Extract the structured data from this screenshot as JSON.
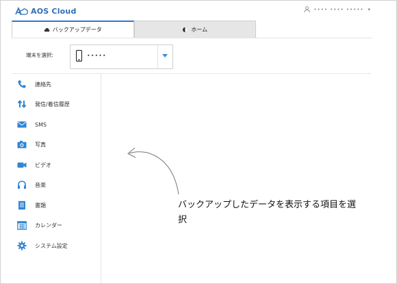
{
  "app": {
    "title": "AOS Cloud"
  },
  "user": {
    "name": "•••• •••• •••••",
    "caret": "▾"
  },
  "tabs": [
    {
      "label": "バックアップデータ",
      "icon": "cloud-icon",
      "active": true
    },
    {
      "label": "ホーム",
      "icon": "home-icon",
      "active": false
    }
  ],
  "device": {
    "label": "端末を選択:",
    "value": "•••••"
  },
  "sidebar": {
    "items": [
      {
        "label": "連絡先",
        "icon": "phone-icon"
      },
      {
        "label": "発信/着信履歴",
        "icon": "call-log-icon"
      },
      {
        "label": "SMS",
        "icon": "envelope-icon"
      },
      {
        "label": "写真",
        "icon": "camera-icon"
      },
      {
        "label": "ビデオ",
        "icon": "video-icon"
      },
      {
        "label": "音楽",
        "icon": "headphones-icon"
      },
      {
        "label": "書類",
        "icon": "document-icon"
      },
      {
        "label": "カレンダー",
        "icon": "calendar-icon"
      },
      {
        "label": "システム設定",
        "icon": "gear-icon"
      }
    ]
  },
  "hint": {
    "text": "バックアップしたデータを表示する項目を選択"
  },
  "colors": {
    "accent": "#2e77c9",
    "icon": "#2f86d3",
    "logo": "#2e6fb5"
  }
}
